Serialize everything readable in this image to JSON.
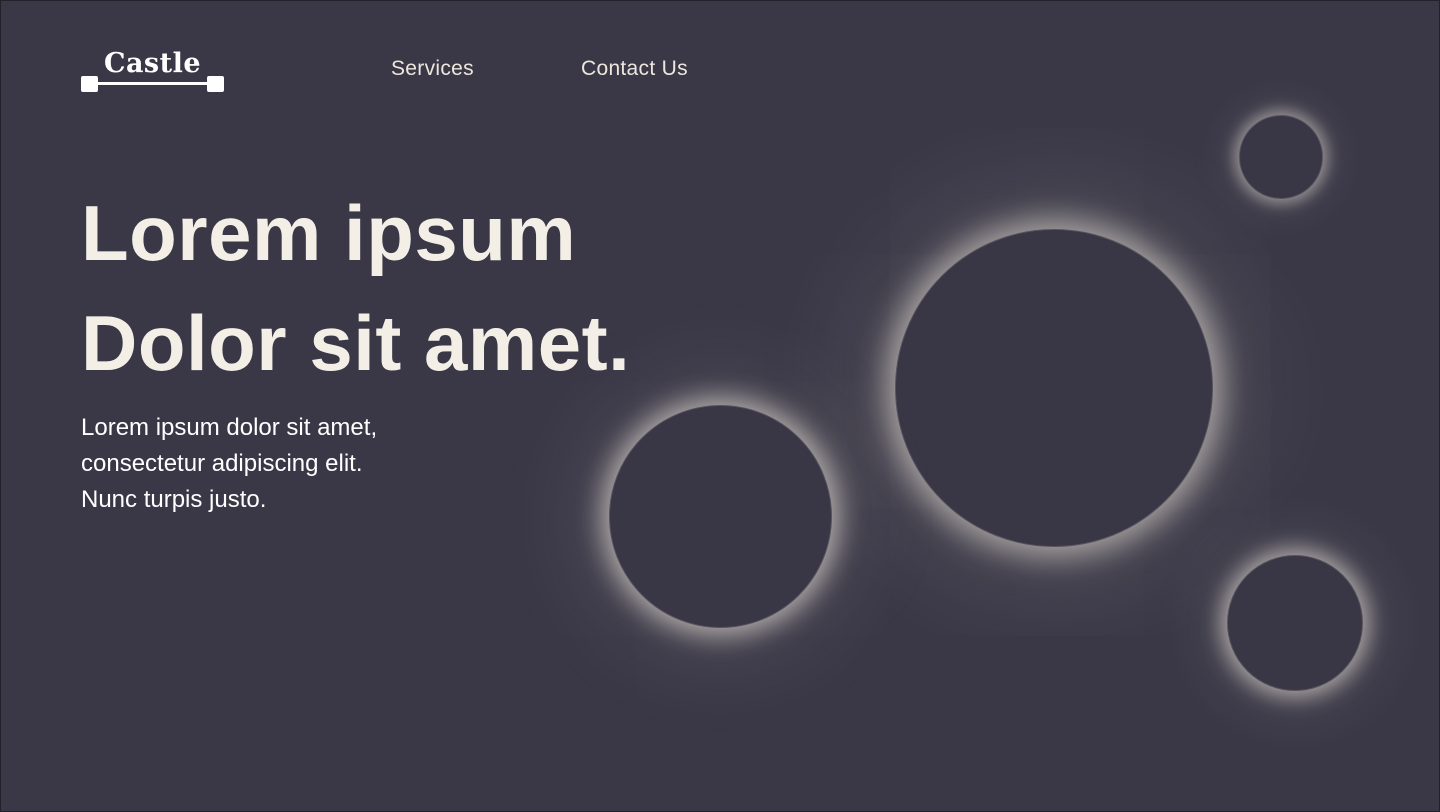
{
  "logo": {
    "text": "Castle"
  },
  "nav": {
    "items": [
      {
        "label": "Services"
      },
      {
        "label": "Contact Us"
      }
    ]
  },
  "hero": {
    "title_line1": "Lorem ipsum",
    "title_line2": "Dolor sit amet.",
    "body_line1": "Lorem ipsum dolor sit amet,",
    "body_line2": "consectetur adipiscing elit.",
    "body_line3": "Nunc turpis justo."
  },
  "colors": {
    "background": "#3a3847",
    "text": "#f4efe6",
    "glow": "#f5eee2"
  }
}
